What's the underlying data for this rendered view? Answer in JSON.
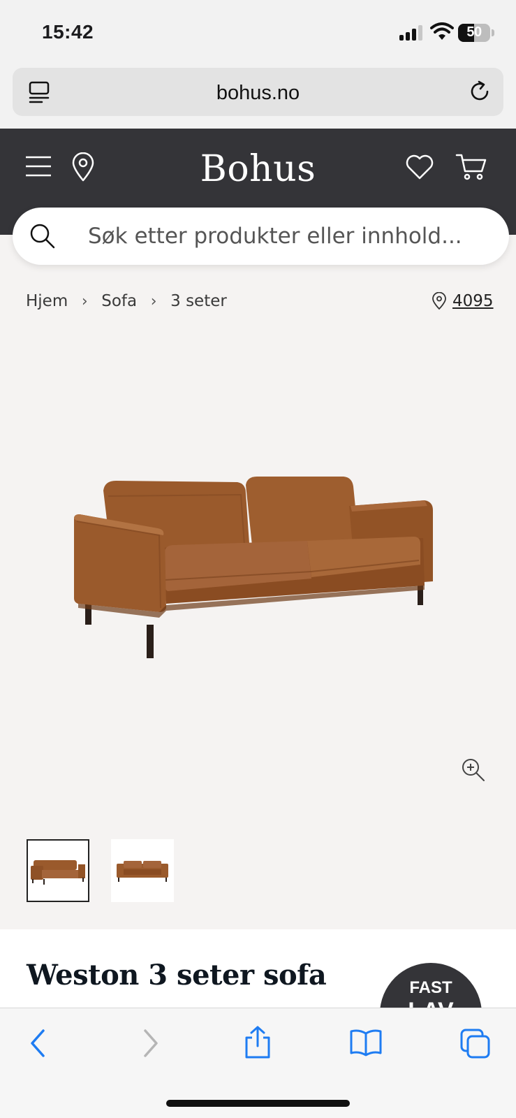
{
  "status_bar": {
    "time": "15:42",
    "battery": "50"
  },
  "browser": {
    "url": "bohus.no"
  },
  "header": {
    "brand": "Bohus"
  },
  "search": {
    "placeholder": "Søk etter produkter eller innhold..."
  },
  "breadcrumb": [
    "Hjem",
    "Sofa",
    "3 seter"
  ],
  "store": {
    "code": "4095"
  },
  "product": {
    "title": "Weston 3 seter sofa",
    "badge_line1": "FAST",
    "badge_line2": "LAV"
  },
  "colors": {
    "header_bg": "#343438",
    "page_bg": "#f5f3f2",
    "sofa_leather": "#9a5a2c",
    "safari_blue": "#1e7cf2"
  },
  "icons": [
    "tabs-list-icon",
    "reload-icon",
    "menu-icon",
    "location-pin-icon",
    "heart-icon",
    "cart-icon",
    "search-icon",
    "chevron-right-icon",
    "zoom-in-icon",
    "back-icon",
    "forward-icon",
    "share-icon",
    "bookmarks-icon",
    "tabs-icon"
  ]
}
